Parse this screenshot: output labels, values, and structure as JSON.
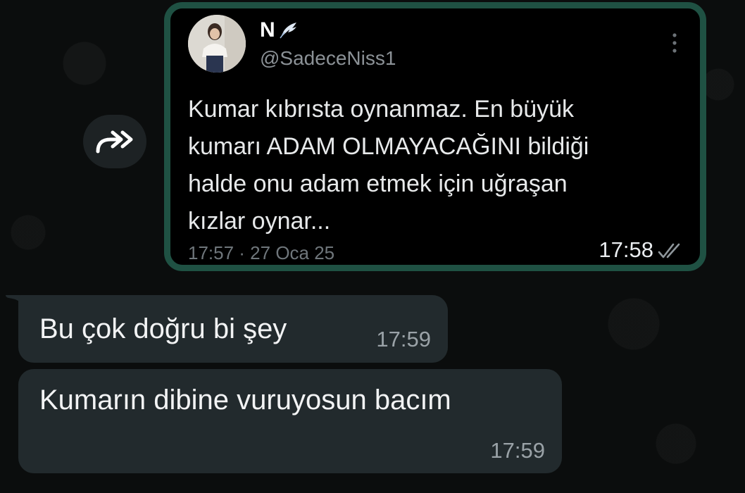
{
  "tweet": {
    "display_name": "N",
    "handle": "@SadeceNiss1",
    "text_lines": [
      "Kumar kıbrısta oynanmaz. En büyük",
      "kumarı ADAM OLMAYACAĞINI bildiği",
      "halde onu adam etmek için uğraşan",
      "kızlar oynar..."
    ],
    "posted_at": "17:57 · 27 Oca 25"
  },
  "outgoing_message": {
    "time": "17:58",
    "status": "read"
  },
  "incoming_messages": [
    {
      "text": "Bu çok doğru bi şey",
      "time": "17:59"
    },
    {
      "text": "Kumarın dibine vuruyosun bacım",
      "time": "17:59"
    }
  ],
  "icons": {
    "forward": "forward-icon",
    "more": "more-vertical-icon",
    "wing": "wing-icon",
    "ticks": "double-check-icon"
  }
}
